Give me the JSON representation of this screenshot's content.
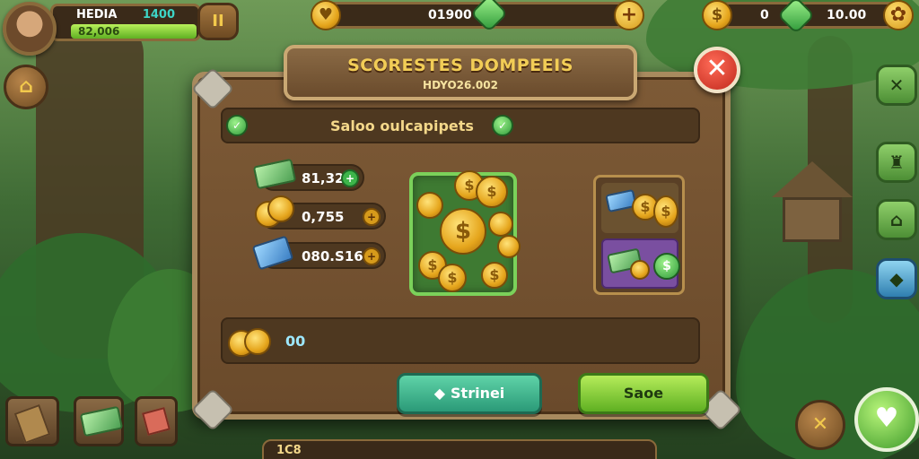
{
  "player": {
    "name": "HEDIA",
    "score": "1400",
    "bar_value": "82,006"
  },
  "buttons": {
    "pause": "II",
    "close": "✕",
    "side_x": "✕",
    "bottom_x": "✕"
  },
  "top_center": {
    "value": "01900",
    "plus": "+"
  },
  "top_right": {
    "value_1": "0",
    "value_2": "10.00",
    "coin_symbol": "$"
  },
  "panel": {
    "title": "SCORESTES DOMPEEIS",
    "subtitle": "HDYO26.002",
    "section_title": "Saloo oulcapipets",
    "resources": [
      {
        "value": "81,328"
      },
      {
        "value": "0,755"
      },
      {
        "value": "080.S16"
      }
    ],
    "reward_value": "00",
    "actions": {
      "left": "Strinei",
      "right": "Saoe"
    }
  },
  "bottom_bar_text": "1C8",
  "colors": {
    "accent_gold": "#f2cd56",
    "close_red": "#c0281c",
    "action_green": "#5fb022",
    "action_teal": "#2b9a78"
  },
  "icons": [
    "avatar",
    "pause-icon",
    "coin-icon",
    "gem-icon",
    "plus-icon",
    "close-icon",
    "clover-icon",
    "bag-icon",
    "boot-icon",
    "map-icon",
    "chat-icon"
  ]
}
